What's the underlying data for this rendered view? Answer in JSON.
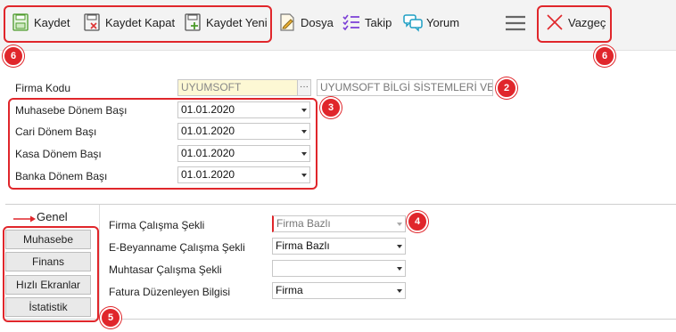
{
  "toolbar": {
    "save": "Kaydet",
    "save_close": "Kaydet Kapat",
    "save_new": "Kaydet Yeni",
    "file": "Dosya",
    "track": "Takip",
    "comment": "Yorum",
    "cancel": "Vazgeç"
  },
  "form": {
    "company_code_label": "Firma Kodu",
    "company_code_value": "UYUMSOFT",
    "company_name_value": "UYUMSOFT BİLGİ SİSTEMLERİ VE",
    "periods": [
      {
        "label": "Muhasebe Dönem Başı",
        "value": "01.01.2020"
      },
      {
        "label": "Cari Dönem Başı",
        "value": "01.01.2020"
      },
      {
        "label": "Kasa Dönem Başı",
        "value": "01.01.2020"
      },
      {
        "label": "Banka Dönem Başı",
        "value": "01.01.2020"
      }
    ]
  },
  "tabs": {
    "active": "Genel",
    "items": [
      "Muhasebe",
      "Finans",
      "Hızlı Ekranlar",
      "İstatistik"
    ]
  },
  "general": {
    "rows": [
      {
        "label": "Firma Çalışma Şekli",
        "value": "Firma Bazlı"
      },
      {
        "label": "E-Beyanname Çalışma Şekli",
        "value": "Firma Bazlı"
      },
      {
        "label": "Muhtasar Çalışma Şekli",
        "value": ""
      },
      {
        "label": "Fatura Düzenleyen Bilgisi",
        "value": "Firma"
      }
    ]
  },
  "annotations": [
    "2",
    "3",
    "4",
    "5",
    "6",
    "6"
  ],
  "colors": {
    "accent_red": "#e0262b",
    "yellow_field": "#fdf8d4",
    "toolbar_bg": "#f3f3f3"
  }
}
